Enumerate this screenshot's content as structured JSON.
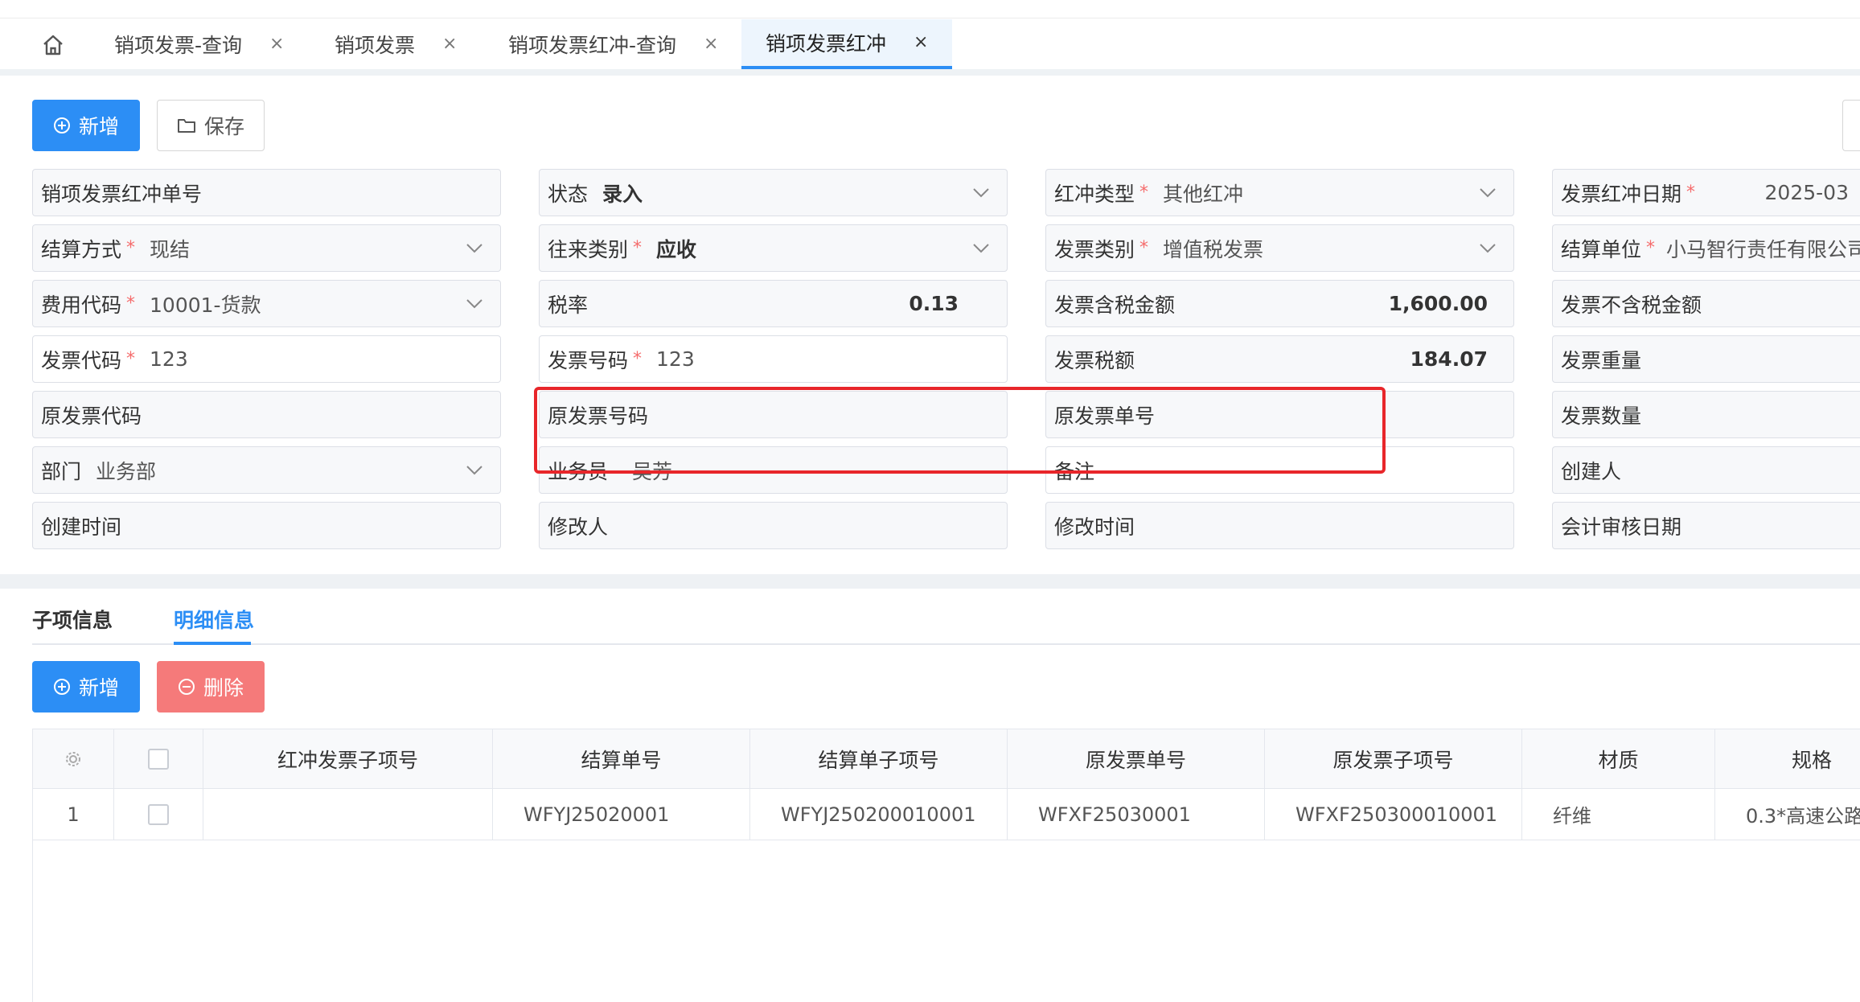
{
  "tabs": {
    "home_icon": "home-icon",
    "items": [
      {
        "label": "销项发票-查询",
        "close": "×",
        "active": false
      },
      {
        "label": "销项发票",
        "close": "×",
        "active": false
      },
      {
        "label": "销项发票红冲-查询",
        "close": "×",
        "active": false
      },
      {
        "label": "销项发票红冲",
        "close": "×",
        "active": true
      }
    ]
  },
  "toolbar": {
    "add_label": "新增",
    "save_label": "保存"
  },
  "form": {
    "red_invoice_no": {
      "label": "销项发票红冲单号",
      "value": ""
    },
    "status": {
      "label": "状态",
      "value": "录入"
    },
    "red_type": {
      "label": "红冲类型",
      "required": "*",
      "value": "其他红冲"
    },
    "red_date": {
      "label": "发票红冲日期",
      "required": "*",
      "value": "2025-03"
    },
    "settle_method": {
      "label": "结算方式",
      "required": "*",
      "value": "现结"
    },
    "trade_type": {
      "label": "往来类别",
      "required": "*",
      "value": "应收"
    },
    "invoice_type": {
      "label": "发票类别",
      "required": "*",
      "value": "增值税发票"
    },
    "settle_unit": {
      "label": "结算单位",
      "required": "*",
      "value": "小马智行责任有限公司"
    },
    "fee_code": {
      "label": "费用代码",
      "required": "*",
      "value": "10001-货款"
    },
    "tax_rate": {
      "label": "税率",
      "value": "0.13"
    },
    "amount_incl_tax": {
      "label": "发票含税金额",
      "value": "1,600.00"
    },
    "amount_excl_tax": {
      "label": "发票不含税金额",
      "value": ""
    },
    "invoice_code": {
      "label": "发票代码",
      "required": "*",
      "value": "123"
    },
    "invoice_number": {
      "label": "发票号码",
      "required": "*",
      "value": "123"
    },
    "tax_amount": {
      "label": "发票税额",
      "value": "184.07"
    },
    "invoice_weight": {
      "label": "发票重量",
      "value": ""
    },
    "orig_invoice_code": {
      "label": "原发票代码",
      "value": ""
    },
    "orig_invoice_number": {
      "label": "原发票号码",
      "value": ""
    },
    "orig_invoice_doc_no": {
      "label": "原发票单号",
      "value": ""
    },
    "invoice_qty": {
      "label": "发票数量",
      "value": ""
    },
    "department": {
      "label": "部门",
      "value": "业务部"
    },
    "salesman": {
      "label": "业务员",
      "value": "吴芳"
    },
    "remark": {
      "label": "备注",
      "value": ""
    },
    "creator": {
      "label": "创建人",
      "value": ""
    },
    "created_time": {
      "label": "创建时间",
      "value": ""
    },
    "modifier": {
      "label": "修改人",
      "value": ""
    },
    "modified_time": {
      "label": "修改时间",
      "value": ""
    },
    "audit_date": {
      "label": "会计审核日期",
      "value": ""
    }
  },
  "subtabs": {
    "items": [
      {
        "label": "子项信息",
        "active": false
      },
      {
        "label": "明细信息",
        "active": true
      }
    ]
  },
  "detail_toolbar": {
    "add_label": "新增",
    "delete_label": "删除"
  },
  "grid": {
    "settings_icon": "gear-icon",
    "columns": [
      "红冲发票子项号",
      "结算单号",
      "结算单子项号",
      "原发票单号",
      "原发票子项号",
      "材质",
      "规格"
    ],
    "rows": [
      {
        "index": "1",
        "cells": [
          "",
          "WFYJ25020001",
          "WFYJ250200010001",
          "WFXF25030001",
          "WFXF250300010001",
          "纤维",
          "0.3*高速公路"
        ]
      }
    ]
  },
  "colors": {
    "primary": "#2c8ef5",
    "danger": "#f57a7a",
    "required": "#f56c6c",
    "annotation": "#e8262a"
  }
}
